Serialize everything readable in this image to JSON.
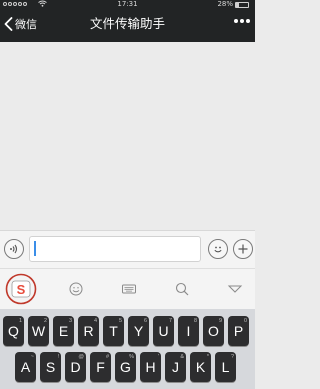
{
  "status_bar": {
    "time": "17:31",
    "battery": "28%",
    "battery_level": 0.28
  },
  "nav": {
    "back_label": "微信",
    "title": "文件传输助手",
    "more_icon": "more-dots-icon"
  },
  "input_bar": {
    "voice_icon": "voice-icon",
    "text_value": "",
    "emoji_icon": "emoji-icon",
    "plus_icon": "plus-icon"
  },
  "keyboard_toolbar": {
    "icons": [
      "sogou-logo-icon",
      "smiley-icon",
      "keyboard-icon",
      "search-icon",
      "collapse-arrow-icon"
    ],
    "logo_letter": "S"
  },
  "keyboard": {
    "row1": [
      {
        "key": "Q",
        "sub": "1"
      },
      {
        "key": "W",
        "sub": "2"
      },
      {
        "key": "E",
        "sub": "3"
      },
      {
        "key": "R",
        "sub": "4"
      },
      {
        "key": "T",
        "sub": "5"
      },
      {
        "key": "Y",
        "sub": "6"
      },
      {
        "key": "U",
        "sub": "7"
      },
      {
        "key": "I",
        "sub": "8"
      },
      {
        "key": "O",
        "sub": "9"
      },
      {
        "key": "P",
        "sub": "0"
      }
    ],
    "row2": [
      {
        "key": "A",
        "sub": "~"
      },
      {
        "key": "S",
        "sub": "!"
      },
      {
        "key": "D",
        "sub": "@"
      },
      {
        "key": "F",
        "sub": "#"
      },
      {
        "key": "G",
        "sub": "%"
      },
      {
        "key": "H",
        "sub": "'"
      },
      {
        "key": "J",
        "sub": "&"
      },
      {
        "key": "K",
        "sub": "*"
      },
      {
        "key": "L",
        "sub": "?"
      }
    ]
  },
  "colors": {
    "nav_background": "#222425",
    "chat_background": "#ebebeb",
    "key_background": "#2d2d2f",
    "highlight_circle": "#c0392b"
  }
}
